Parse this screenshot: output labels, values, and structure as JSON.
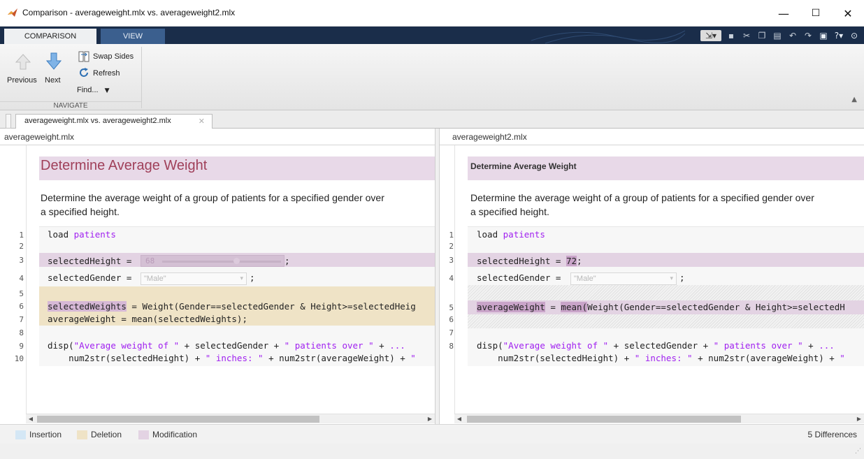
{
  "window": {
    "title": "Comparison - averageweight.mlx vs. averageweight2.mlx",
    "minimize": "—",
    "maximize": "☐",
    "close": "✕"
  },
  "ribbon": {
    "tabs": [
      {
        "label": "COMPARISON",
        "active": true
      },
      {
        "label": "VIEW",
        "active": false
      }
    ],
    "navigate": {
      "previous_label": "Previous",
      "next_label": "Next",
      "swap_label": "Swap Sides",
      "refresh_label": "Refresh",
      "find_label": "Find...",
      "section_label": "NAVIGATE"
    }
  },
  "document_tab": {
    "label": "averageweight.mlx vs. averageweight2.mlx"
  },
  "left": {
    "filename": "averageweight.mlx",
    "heading": "Determine Average Weight",
    "para_line1": "Determine the average weight of a group of patients for a specified gender over",
    "para_line2": "a specified height.",
    "lines": [
      {
        "n": "1",
        "text": "load patients"
      },
      {
        "n": "2",
        "text": ""
      },
      {
        "n": "3",
        "text": "selectedHeight = 68"
      },
      {
        "n": "4",
        "text": "selectedGender = \"Male\";"
      },
      {
        "n": "5",
        "text": ""
      },
      {
        "n": "6",
        "text": "selectedWeights = Weight(Gender==selectedGender & Height>=selectedHeig"
      },
      {
        "n": "7",
        "text": "averageWeight = mean(selectedWeights);"
      },
      {
        "n": "8",
        "text": ""
      },
      {
        "n": "9",
        "text": "disp(\"Average weight of \" + selectedGender + \" patients over \" + ..."
      },
      {
        "n": "10",
        "text": "    num2str(selectedHeight) + \" inches: \" + num2str(averageWeight) + \""
      }
    ],
    "slider_value": "68",
    "dropdown_value": "\"Male\""
  },
  "right": {
    "filename": "averageweight2.mlx",
    "heading": "Determine Average Weight",
    "para_line1": "Determine the average weight of a group of patients for a specified gender over",
    "para_line2": "a specified height.",
    "lines": [
      {
        "n": "1",
        "text": "load patients"
      },
      {
        "n": "2",
        "text": ""
      },
      {
        "n": "3",
        "text": "selectedHeight = 72;"
      },
      {
        "n": "4",
        "text": "selectedGender = \"Male\";"
      },
      {
        "n": "5",
        "text": "averageWeight = mean(Weight(Gender==selectedGender & Height>=selectedH"
      },
      {
        "n": "6",
        "text": ""
      },
      {
        "n": "7",
        "text": ""
      },
      {
        "n": "8",
        "text": "disp(\"Average weight of \" + selectedGender + \" patients over \" + ..."
      },
      {
        "n": "",
        "text": "    num2str(selectedHeight) + \" inches: \" + num2str(averageWeight) + \""
      }
    ],
    "dropdown_value": "\"Male\""
  },
  "legend": {
    "insertion": "Insertion",
    "deletion": "Deletion",
    "modification": "Modification",
    "differences": "5 Differences"
  },
  "colors": {
    "insertion": "#d4e7f5",
    "deletion": "#efe3c6",
    "modification": "#e3d3e3",
    "heading_text": "#a0405a",
    "ribbon_dark": "#1a2d4a"
  }
}
